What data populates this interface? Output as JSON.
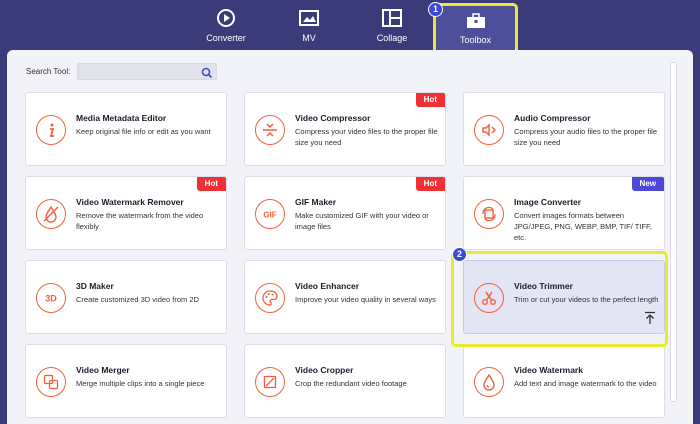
{
  "nav": {
    "tabs": [
      {
        "label": "Converter",
        "icon": "converter-icon"
      },
      {
        "label": "MV",
        "icon": "mv-icon"
      },
      {
        "label": "Collage",
        "icon": "collage-icon"
      },
      {
        "label": "Toolbox",
        "icon": "toolbox-icon",
        "active": true
      }
    ]
  },
  "annotations": {
    "badge1": "1",
    "badge2": "2",
    "highlight_color": "#e9ea2f"
  },
  "search": {
    "label": "Search Tool:",
    "value": "",
    "placeholder": ""
  },
  "colors": {
    "accent": "#f0603a",
    "hot": "#ee3134",
    "new": "#4d48d6",
    "background": "#3a3b78"
  },
  "tools": [
    {
      "title": "Media Metadata Editor",
      "desc": "Keep original file info or edit as you want",
      "icon": "info-icon"
    },
    {
      "title": "Video Compressor",
      "desc": "Compress your video files to the proper file size you need",
      "icon": "compress-icon",
      "tag": "Hot"
    },
    {
      "title": "Audio Compressor",
      "desc": "Compress your audio files to the proper file size you need",
      "icon": "audio-compress-icon"
    },
    {
      "title": "Video Watermark Remover",
      "desc": "Remove the watermark from the video flexibly",
      "icon": "watermark-remove-icon",
      "tag": "Hot"
    },
    {
      "title": "GIF Maker",
      "desc": "Make customized GIF with your video or image files",
      "icon": "gif-icon",
      "tag": "Hot"
    },
    {
      "title": "Image Converter",
      "desc": "Convert images formats between JPG/JPEG, PNG, WEBP, BMP, TIF/ TIFF, etc.",
      "icon": "image-convert-icon",
      "tag": "New"
    },
    {
      "title": "3D Maker",
      "desc": "Create customized 3D video from 2D",
      "icon": "3d-icon"
    },
    {
      "title": "Video Enhancer",
      "desc": "Improve your video quality in several ways",
      "icon": "palette-icon"
    },
    {
      "title": "Video Trimmer",
      "desc": "Trim or cut your videos to the perfect length",
      "icon": "scissors-icon",
      "selected": true
    },
    {
      "title": "Video Merger",
      "desc": "Merge multiple clips into a single piece",
      "icon": "merge-icon"
    },
    {
      "title": "Video Cropper",
      "desc": "Crop the redundant video footage",
      "icon": "crop-icon"
    },
    {
      "title": "Video Watermark",
      "desc": "Add text and image watermark to the video",
      "icon": "droplet-icon"
    }
  ],
  "icon_texts": {
    "gif": "GIF",
    "three_d": "3D"
  }
}
